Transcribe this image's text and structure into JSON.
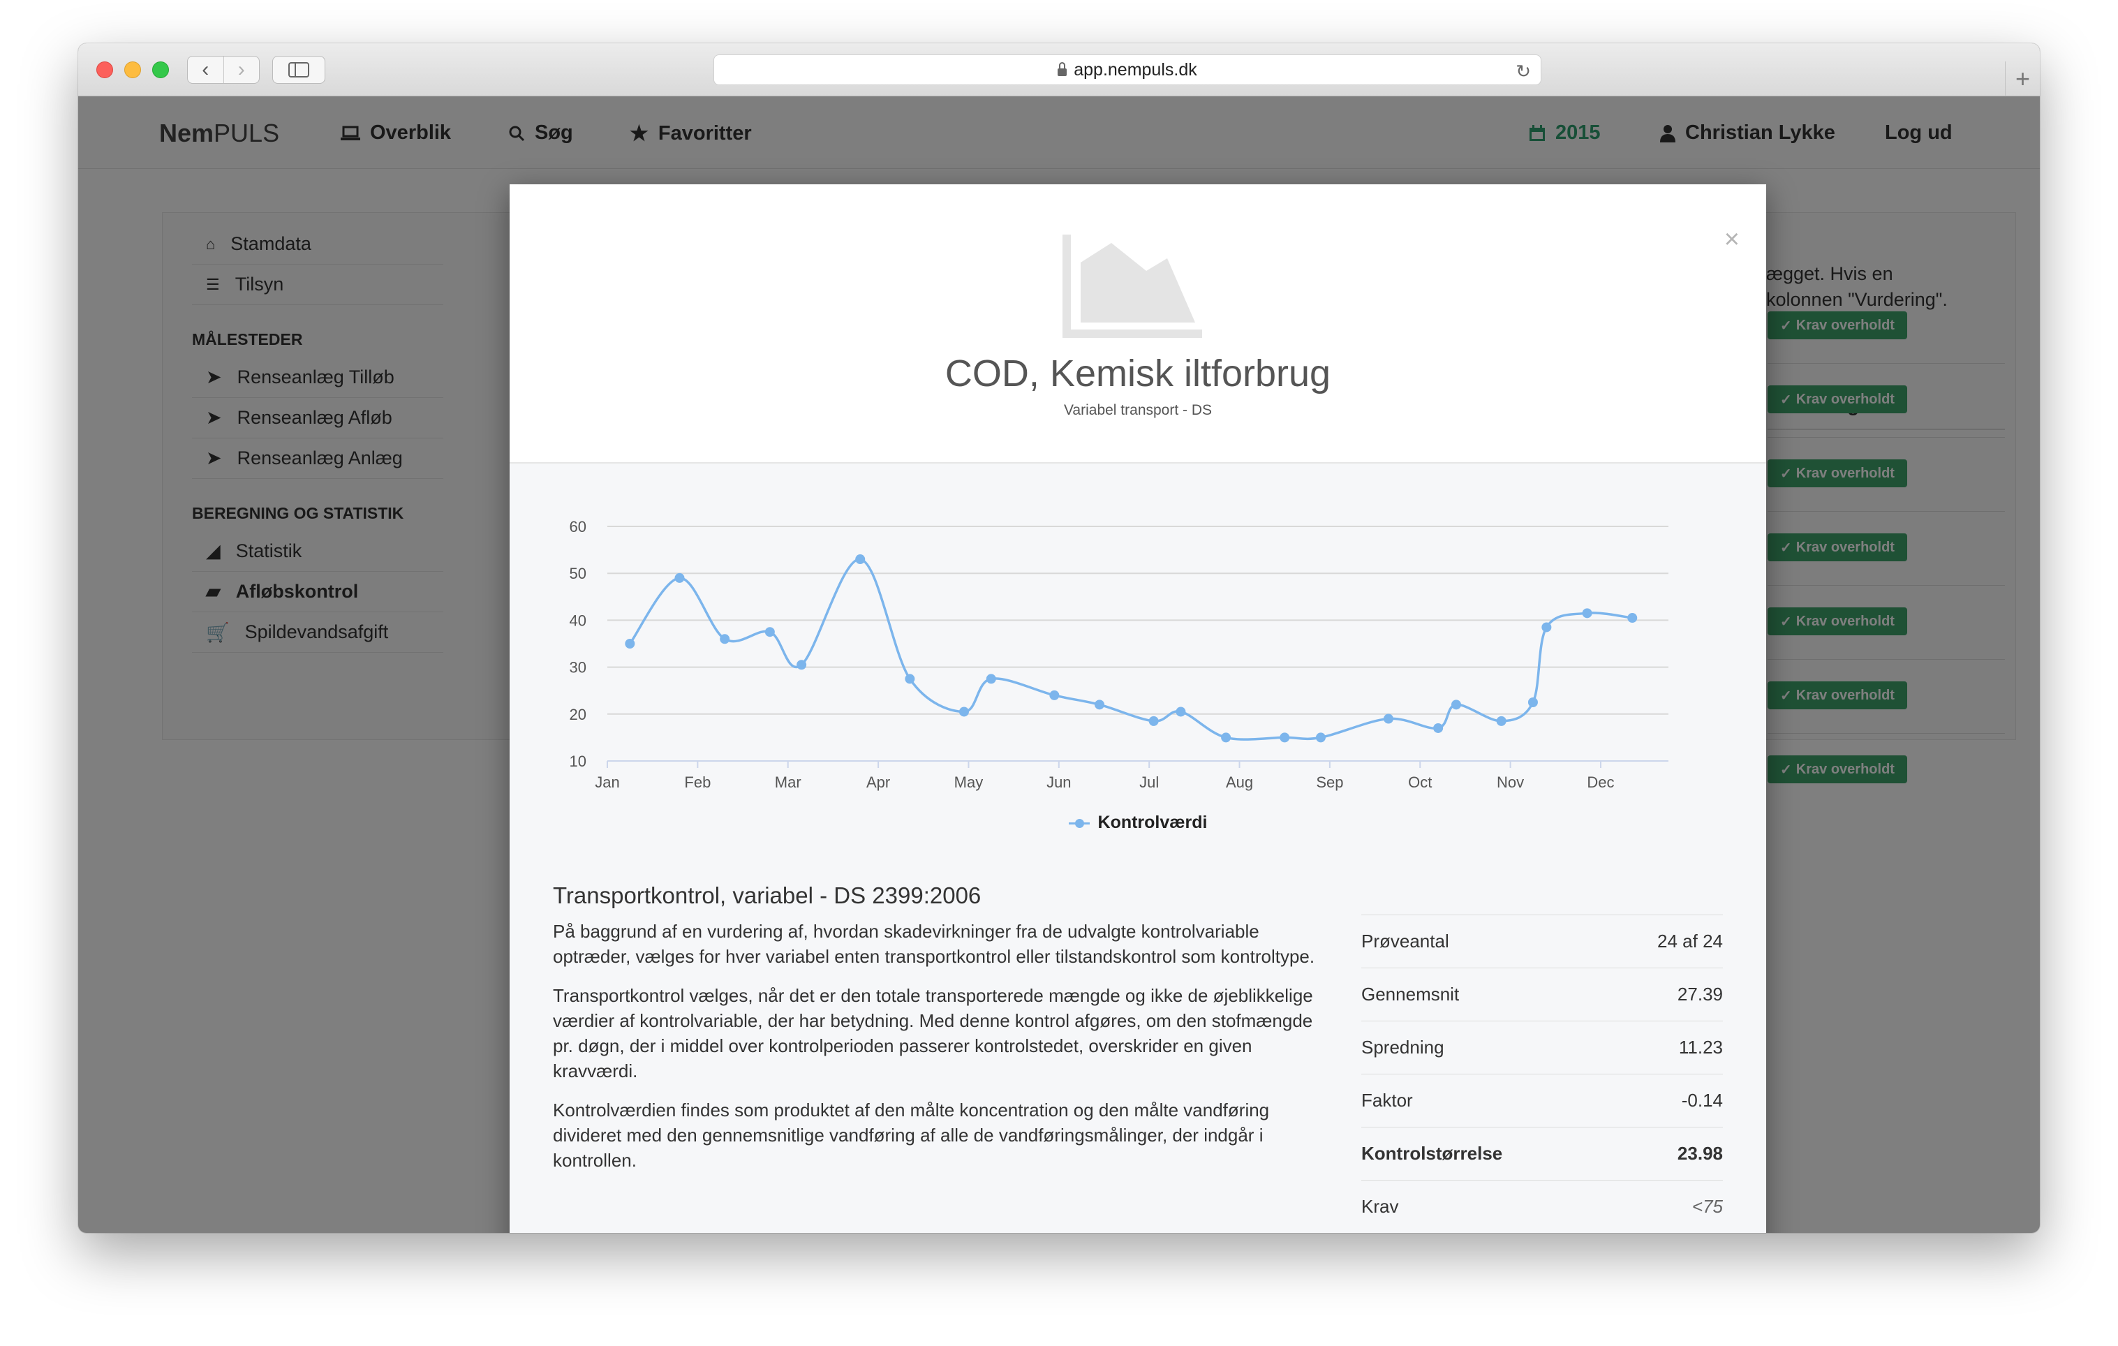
{
  "browser": {
    "url": "app.nempuls.dk"
  },
  "topnav": {
    "brand_bold": "Nem",
    "brand_rest": "PULS",
    "items": [
      {
        "label": "Overblik",
        "icon": "laptop-icon"
      },
      {
        "label": "Søg",
        "icon": "search-icon"
      },
      {
        "label": "Favoritter",
        "icon": "star-icon"
      }
    ],
    "year": "2015",
    "user": "Christian Lykke",
    "logout": "Log ud",
    "accent_color": "#2e9e6e"
  },
  "sidebar": {
    "top_items": [
      {
        "label": "Stamdata",
        "icon": "home-icon"
      },
      {
        "label": "Tilsyn",
        "icon": "list-icon"
      }
    ],
    "section1_heading": "MÅLESTEDER",
    "section1_items": [
      {
        "label": "Renseanlæg Tilløb",
        "icon": "location-arrow-icon"
      },
      {
        "label": "Renseanlæg Afløb",
        "icon": "location-arrow-icon"
      },
      {
        "label": "Renseanlæg Anlæg",
        "icon": "location-arrow-icon"
      }
    ],
    "section2_heading": "BEREGNING OG STATISTIK",
    "section2_items": [
      {
        "label": "Statistik",
        "icon": "area-chart-icon"
      },
      {
        "label": "Afløbskontrol",
        "icon": "truck-icon",
        "active": true
      },
      {
        "label": "Spildevandsafgift",
        "icon": "cart-icon"
      }
    ]
  },
  "background": {
    "text_line1": "ægget. Hvis en",
    "text_line2": "kolonnen \"Vurdering\".",
    "vurdering_heading": "Vurdering",
    "badge_label": "Krav overholdt",
    "badge_color": "#3fa36b",
    "badge_count": 7
  },
  "modal": {
    "title": "COD, Kemisk iltforbrug",
    "subtitle": "Variabel transport - DS",
    "close": "×",
    "section_title": "Transportkontrol, variabel - DS 2399:2006",
    "paragraphs": [
      "På baggrund af en vurdering af, hvordan skadevirkninger fra de udvalgte kontrolvariable optræder, vælges for hver variabel enten transportkontrol eller tilstandskontrol som kontroltype.",
      "Transportkontrol vælges, når det er den totale transporterede mængde og ikke de øjeblikkelige værdier af kontrolvariable, der har betydning. Med denne kontrol afgøres, om den stofmængde pr. døgn, der i middel over kontrolperioden passerer kontrolstedet, overskrider en given kravværdi.",
      "Kontrolværdien findes som produktet af den målte koncentration og den målte vandføring divideret med den gennemsnitlige vandføring af alle de vandføringsmålinger, der indgår i kontrollen."
    ],
    "stats": [
      {
        "label": "Prøveantal",
        "value": "24 af 24"
      },
      {
        "label": "Gennemsnit",
        "value": "27.39"
      },
      {
        "label": "Spredning",
        "value": "11.23"
      },
      {
        "label": "Faktor",
        "value": "-0.14"
      },
      {
        "label": "Kontrolstørrelse",
        "value": "23.98",
        "bold": true
      },
      {
        "label": "Krav",
        "value": "<75",
        "italic": true
      }
    ]
  },
  "chart_data": {
    "type": "line",
    "title": "",
    "xlabel": "",
    "ylabel": "",
    "ylim": [
      10,
      60
    ],
    "yticks": [
      10,
      20,
      30,
      40,
      50,
      60
    ],
    "xticks": [
      "Jan",
      "Feb",
      "Mar",
      "Apr",
      "May",
      "Jun",
      "Jul",
      "Aug",
      "Sep",
      "Oct",
      "Nov",
      "Dec"
    ],
    "grid": true,
    "legend_position": "bottom-center",
    "series": [
      {
        "name": "Kontrolværdi",
        "color": "#7cb5ec",
        "x": [
          0.25,
          0.8,
          1.3,
          1.8,
          2.15,
          2.8,
          3.35,
          3.95,
          4.25,
          4.95,
          5.45,
          6.05,
          6.35,
          6.85,
          7.5,
          7.9,
          8.65,
          9.2,
          9.4,
          9.9,
          10.25,
          10.4,
          10.85,
          11.35
        ],
        "values": [
          35,
          49,
          36,
          37.5,
          30.5,
          53,
          27.5,
          20.5,
          27.5,
          24,
          22,
          18.5,
          20.5,
          15,
          15,
          15,
          19,
          17,
          22,
          18.5,
          22.5,
          38.5,
          41.5,
          40.5
        ]
      }
    ]
  }
}
